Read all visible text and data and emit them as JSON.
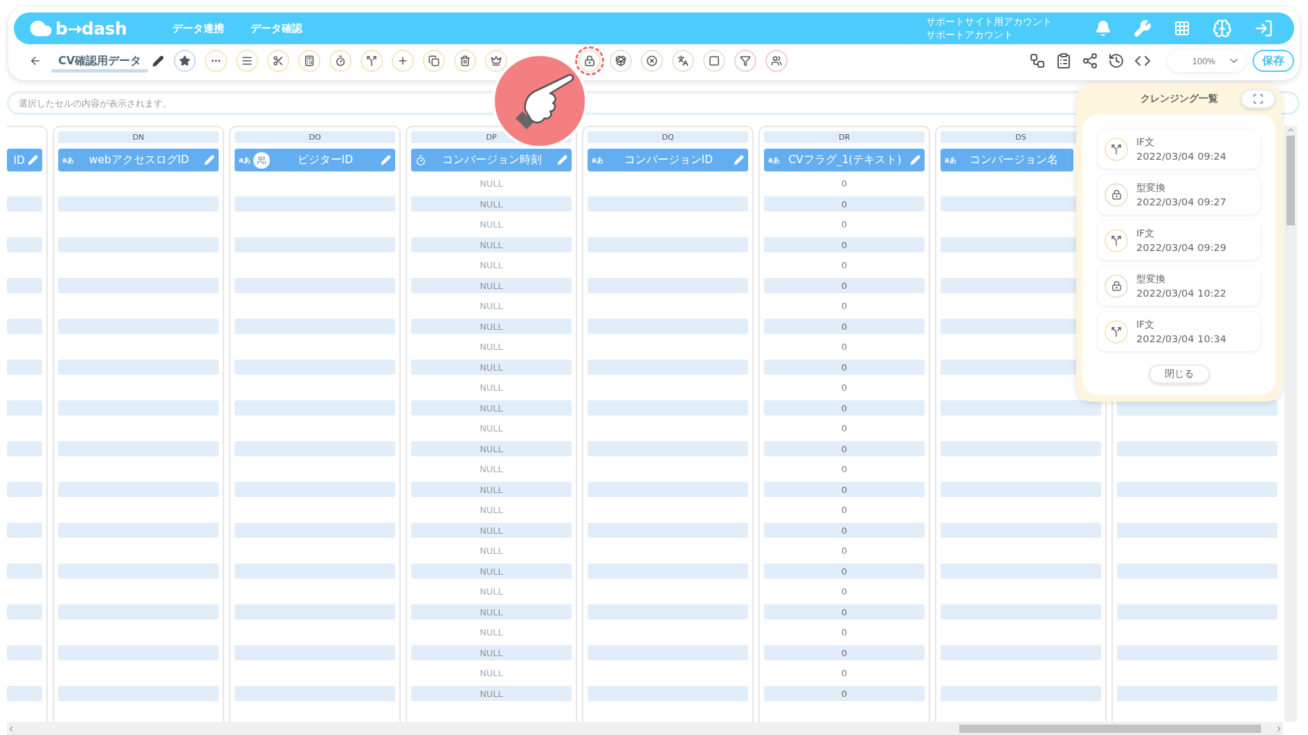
{
  "header": {
    "logo": "b→dash",
    "nav": [
      "データ連携",
      "データ確認"
    ],
    "account": [
      "サポートサイト用アカウント",
      "サポートアカウント"
    ]
  },
  "toolbar": {
    "title": "CV確認用データ",
    "tools": [
      {
        "color": "#c9ddf1",
        "highlighted": false
      },
      {
        "color": "#f5e6bd",
        "highlighted": false
      },
      {
        "color": "#f5e6bd",
        "highlighted": false
      },
      {
        "color": "#f5e6bd",
        "highlighted": false
      },
      {
        "color": "#f5e6bd",
        "highlighted": false
      },
      {
        "color": "#f5e6bd",
        "highlighted": false
      },
      {
        "color": "#f5e6bd",
        "highlighted": false
      },
      {
        "color": "#f5e6bd",
        "highlighted": false
      },
      {
        "color": "#f5e6bd",
        "highlighted": false
      },
      {
        "color": "#f5e6bd",
        "highlighted": false
      },
      {
        "color": "#f5e6bd",
        "highlighted": false
      },
      {
        "color": "#e2e7d0",
        "highlighted": true
      },
      {
        "color": "#e2e7d0",
        "highlighted": false
      },
      {
        "color": "#e2e7d0",
        "highlighted": false
      },
      {
        "color": "#e2e7d0",
        "highlighted": false
      },
      {
        "color": "#e2e7d0",
        "highlighted": false
      },
      {
        "color": "#f6cccc",
        "highlighted": false
      },
      {
        "color": "#f6cccc",
        "highlighted": false
      }
    ],
    "zoom": "100%",
    "save": "保存"
  },
  "formula_bar": {
    "placeholder": "選択したセルの内容が表示されます。"
  },
  "columns": [
    {
      "title": "ID",
      "editable": true
    },
    {
      "letter": "DN",
      "kind": "text",
      "type_label": "aあ",
      "title": "webアクセスログID",
      "editable": true
    },
    {
      "letter": "DO",
      "kind": "text",
      "type_label": "aあ",
      "avatar": true,
      "title": "ビジターID",
      "editable": true
    },
    {
      "letter": "DP",
      "kind": "datetime",
      "title": "コンバージョン時刻",
      "editable": true,
      "values": [
        "NULL",
        "NULL",
        "NULL",
        "NULL",
        "NULL",
        "NULL",
        "NULL",
        "NULL",
        "NULL",
        "NULL",
        "NULL",
        "NULL",
        "NULL",
        "NULL",
        "NULL",
        "NULL",
        "NULL",
        "NULL",
        "NULL",
        "NULL",
        "NULL",
        "NULL",
        "NULL",
        "NULL",
        "NULL",
        "NULL"
      ]
    },
    {
      "letter": "DQ",
      "kind": "text",
      "type_label": "aあ",
      "title": "コンバージョンID",
      "editable": true
    },
    {
      "letter": "DR",
      "kind": "text",
      "type_label": "aあ",
      "title": "CVフラグ_1(テキスト)",
      "editable": true,
      "values": [
        "0",
        "0",
        "0",
        "0",
        "0",
        "0",
        "0",
        "0",
        "0",
        "0",
        "0",
        "0",
        "0",
        "0",
        "0",
        "0",
        "0",
        "0",
        "0",
        "0",
        "0",
        "0",
        "0",
        "0",
        "0",
        "0"
      ]
    },
    {
      "letter": "DS",
      "kind": "text",
      "type_label": "aあ",
      "title": "コンバージョン名",
      "editable": false
    },
    {}
  ],
  "cleansing_panel": {
    "title": "クレンジング一覧",
    "items": [
      {
        "kind": "if",
        "label": "IF文",
        "time": "2022/03/04 09:24"
      },
      {
        "kind": "convert",
        "label": "型変換",
        "time": "2022/03/04 09:27"
      },
      {
        "kind": "if",
        "label": "IF文",
        "time": "2022/03/04 09:29"
      },
      {
        "kind": "convert",
        "label": "型変換",
        "time": "2022/03/04 10:22"
      },
      {
        "kind": "if",
        "label": "IF文",
        "time": "2022/03/04 10:34"
      }
    ],
    "close": "閉じる"
  }
}
